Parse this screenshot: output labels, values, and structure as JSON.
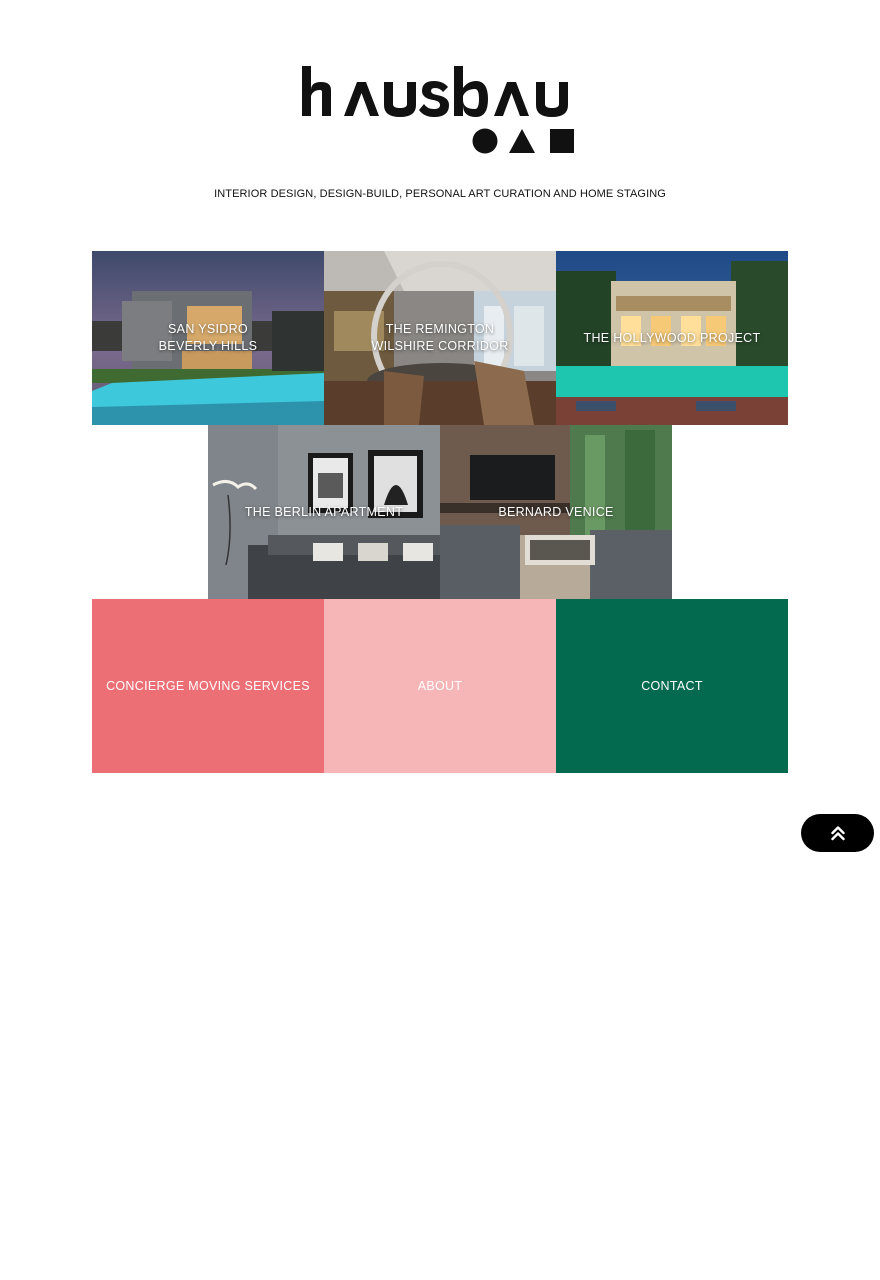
{
  "brand": {
    "logo_text": "hausbau",
    "tagline": "INTERIOR DESIGN, DESIGN-BUILD, PERSONAL ART CURATION AND HOME STAGING"
  },
  "projects": [
    {
      "label": "SAN YSIDRO\nBEVERLY HILLS"
    },
    {
      "label": "THE REMINGTON\nWILSHIRE CORRIDOR"
    },
    {
      "label": "THE HOLLYWOOD PROJECT"
    },
    {
      "label": "THE BERLIN APARTMENT"
    },
    {
      "label": "BERNARD VENICE"
    }
  ],
  "links": [
    {
      "label": "CONCIERGE MOVING SERVICES",
      "color": "#ed6f76"
    },
    {
      "label": "ABOUT",
      "color": "#f6b5b6"
    },
    {
      "label": "CONTACT",
      "color": "#036a4f"
    }
  ],
  "back_to_top": {
    "icon": "double-chevron-up-icon"
  }
}
